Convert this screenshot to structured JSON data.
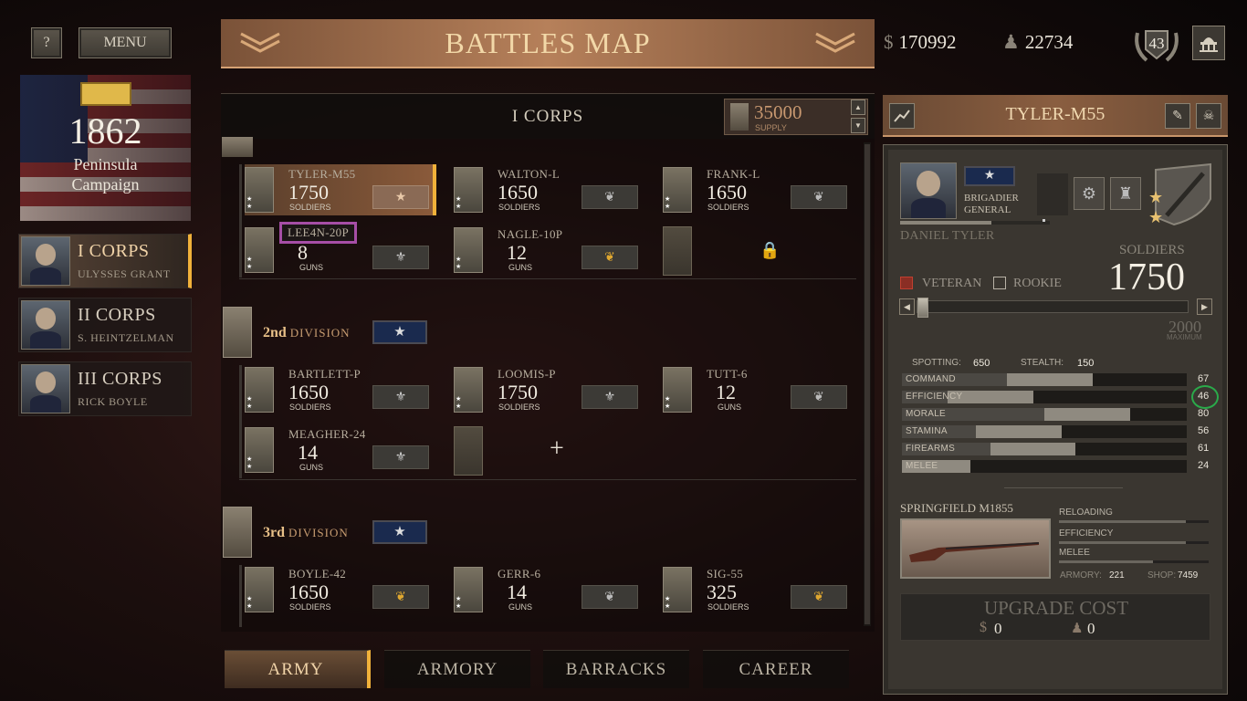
{
  "top": {
    "help_label": "?",
    "menu_label": "MENU",
    "title": "BATTLES MAP",
    "money": "170992",
    "soldiers": "22734",
    "level": "43"
  },
  "campaign": {
    "year": "1862",
    "name_line1": "Peninsula",
    "name_line2": "Campaign"
  },
  "corps": [
    {
      "name": "I CORPS",
      "leader": "ULYSSES GRANT",
      "active": true
    },
    {
      "name": "II CORPS",
      "leader": "S. HEINTZELMAN",
      "active": false
    },
    {
      "name": "III CORPS",
      "leader": "RICK BOYLE",
      "active": false
    }
  ],
  "corps_header": {
    "title": "I CORPS",
    "supply_value": "35000",
    "supply_label": "SUPPLY"
  },
  "division1": {
    "units": [
      {
        "name": "TYLER-M55",
        "count": "1750",
        "unit": "SOLDIERS"
      },
      {
        "name": "WALTON-L",
        "count": "1650",
        "unit": "SOLDIERS"
      },
      {
        "name": "FRANK-L",
        "count": "1650",
        "unit": "SOLDIERS"
      },
      {
        "name": "LEE4N-20P",
        "count": "8",
        "unit": "GUNS"
      },
      {
        "name": "NAGLE-10P",
        "count": "12",
        "unit": "GUNS"
      }
    ]
  },
  "division2": {
    "num": "2nd",
    "label": "DIVISION",
    "units": [
      {
        "name": "BARTLETT-P",
        "count": "1650",
        "unit": "SOLDIERS"
      },
      {
        "name": "LOOMIS-P",
        "count": "1750",
        "unit": "SOLDIERS"
      },
      {
        "name": "TUTT-6",
        "count": "12",
        "unit": "GUNS"
      },
      {
        "name": "MEAGHER-24",
        "count": "14",
        "unit": "GUNS"
      }
    ],
    "add_label": "+"
  },
  "division3": {
    "num": "3rd",
    "label": "DIVISION",
    "units": [
      {
        "name": "BOYLE-42",
        "count": "1650",
        "unit": "SOLDIERS"
      },
      {
        "name": "GERR-6",
        "count": "14",
        "unit": "GUNS"
      },
      {
        "name": "SIG-55",
        "count": "325",
        "unit": "SOLDIERS"
      }
    ]
  },
  "tabs": [
    "ARMY",
    "ARMORY",
    "BARRACKS",
    "CAREER"
  ],
  "details": {
    "title": "TYLER-M55",
    "rank_line1": "BRIGADIER",
    "rank_line2": "GENERAL",
    "commander": "DANIEL TYLER",
    "soldiers_label": "SOLDIERS",
    "soldiers_value": "1750",
    "veteran_label": "VETERAN",
    "rookie_label": "ROOKIE",
    "maximum_value": "2000",
    "maximum_label": "MAXIMUM",
    "slider_fraction": 0.0,
    "spotting_label": "SPOTTING:",
    "spotting_value": "650",
    "stealth_label": "STEALTH:",
    "stealth_value": "150",
    "stats": [
      {
        "label": "COMMAND",
        "value": "67",
        "fill": 0.67
      },
      {
        "label": "EFFICIENCY",
        "value": "46",
        "fill": 0.46
      },
      {
        "label": "MORALE",
        "value": "80",
        "fill": 0.8
      },
      {
        "label": "STAMINA",
        "value": "56",
        "fill": 0.56
      },
      {
        "label": "FIREARMS",
        "value": "61",
        "fill": 0.61
      },
      {
        "label": "MELEE",
        "value": "24",
        "fill": 0.24
      }
    ],
    "weapon": {
      "name": "SPRINGFIELD M1855",
      "reloading_label": "RELOADING",
      "efficiency_label": "EFFICIENCY",
      "melee_label": "MELEE",
      "reloading_fill": 0.85,
      "efficiency_fill": 0.85,
      "melee_fill": 0.63,
      "armory_label": "ARMORY:",
      "armory_value": "221",
      "shop_label": "SHOP:",
      "shop_value": "7459"
    },
    "upgrade": {
      "label": "UPGRADE COST",
      "money": "0",
      "soldiers": "0"
    }
  },
  "icons": [
    "question-icon",
    "chevron-down-icon",
    "dollar-icon",
    "soldier-icon",
    "laurel-level-icon",
    "capitol-icon",
    "rifle-badge-icon",
    "chart-icon",
    "edit-icon",
    "skull-icon",
    "lock-icon",
    "star-icon",
    "eagle-icon",
    "leaf-icon"
  ]
}
